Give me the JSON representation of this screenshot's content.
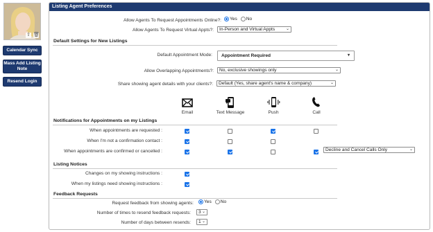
{
  "sidebar": {
    "buttons": [
      {
        "label": "Calendar Sync"
      },
      {
        "label": "Mass Add Listing Note"
      },
      {
        "label": "Resend Login"
      }
    ]
  },
  "panel": {
    "title": "Listing Agent Preferences",
    "appointments_online": {
      "label": "Allow Agents To Request Appointments Online?:",
      "yes": "Yes",
      "no": "No",
      "selected": "Yes"
    },
    "virtual_appts": {
      "label": "Allow Agents To Request Virtual Appts?:",
      "value": "In-Person and Virtual Appts"
    },
    "defaults": {
      "title": "Default Settings for New Listings",
      "appointment_mode": {
        "label": "Default Appointment Mode:",
        "value": "Appointment Required"
      },
      "overlapping": {
        "label": "Allow Overlapping Appointments?:",
        "value": "No, exclusive showings only"
      },
      "share_details": {
        "label": "Share showing agent details with your clients?:",
        "value": "Default (Yes, share agent's name & company)"
      }
    },
    "channels": [
      "Email",
      "Text Message",
      "Push",
      "Call"
    ],
    "notifications": {
      "title": "Notifications for Appointments on my Listings",
      "rows": [
        {
          "label": "When appointments are requested :",
          "checks": [
            true,
            false,
            true,
            false
          ]
        },
        {
          "label": "When I'm not a confirmation contact :",
          "checks": [
            true,
            false,
            false,
            false
          ]
        },
        {
          "label": "When appointments are confirmed or cancelled :",
          "checks": [
            true,
            true,
            false,
            true
          ]
        }
      ],
      "call_select": "Decline and Cancel Calls Only"
    },
    "listing_notices": {
      "title": "Listing Notices",
      "rows": [
        {
          "label": "Changes on my showing instructions :",
          "checked": true
        },
        {
          "label": "When my listings need showing instructions :",
          "checked": true
        }
      ]
    },
    "feedback": {
      "title": "Feedback Requests",
      "request": {
        "label": "Request feedback from showing agents:",
        "yes": "Yes",
        "no": "No",
        "selected": "Yes"
      },
      "resend_times": {
        "label": "Number of times to resend feedback requests:",
        "value": "3"
      },
      "days_between": {
        "label": "Number of days between resends:",
        "value": "1"
      }
    }
  }
}
